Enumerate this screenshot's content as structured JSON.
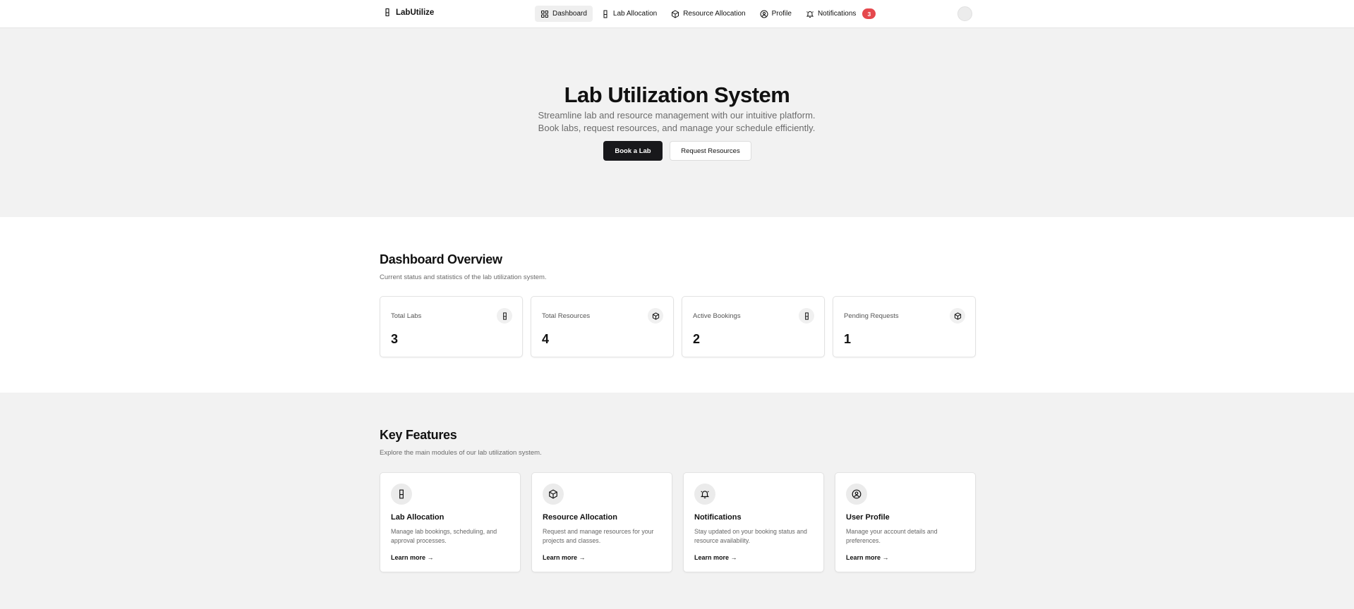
{
  "brand": {
    "name": "LabUtilize"
  },
  "nav": {
    "items": [
      {
        "label": "Dashboard",
        "icon": "grid-icon",
        "active": true
      },
      {
        "label": "Lab Allocation",
        "icon": "flask-icon"
      },
      {
        "label": "Resource Allocation",
        "icon": "box-icon"
      },
      {
        "label": "Profile",
        "icon": "user-circle-icon"
      },
      {
        "label": "Notifications",
        "icon": "bell-icon",
        "badge": "3"
      }
    ]
  },
  "hero": {
    "title": "Lab Utilization System",
    "subtitle": "Streamline lab and resource management with our intuitive platform. Book labs, request resources, and manage your schedule efficiently.",
    "primary_button": "Book a Lab",
    "secondary_button": "Request Resources"
  },
  "dashboard": {
    "title": "Dashboard Overview",
    "subtitle": "Current status and statistics of the lab utilization system.",
    "stats": [
      {
        "label": "Total Labs",
        "value": "3",
        "icon": "flask-icon"
      },
      {
        "label": "Total Resources",
        "value": "4",
        "icon": "box-icon"
      },
      {
        "label": "Active Bookings",
        "value": "2",
        "icon": "flask-icon"
      },
      {
        "label": "Pending Requests",
        "value": "1",
        "icon": "box-icon"
      }
    ]
  },
  "features": {
    "title": "Key Features",
    "subtitle": "Explore the main modules of our lab utilization system.",
    "cards": [
      {
        "title": "Lab Allocation",
        "description": "Manage lab bookings, scheduling, and approval processes.",
        "link": "Learn more →",
        "icon": "flask-icon"
      },
      {
        "title": "Resource Allocation",
        "description": "Request and manage resources for your projects and classes.",
        "link": "Learn more →",
        "icon": "box-icon"
      },
      {
        "title": "Notifications",
        "description": "Stay updated on your booking status and resource availability.",
        "link": "Learn more →",
        "icon": "bell-icon"
      },
      {
        "title": "User Profile",
        "description": "Manage your account details and preferences.",
        "link": "Learn more →",
        "icon": "user-circle-icon"
      }
    ]
  },
  "colors": {
    "accent": "#18181b",
    "badge": "#e5484d",
    "section_bg": "#f2f2f2"
  }
}
